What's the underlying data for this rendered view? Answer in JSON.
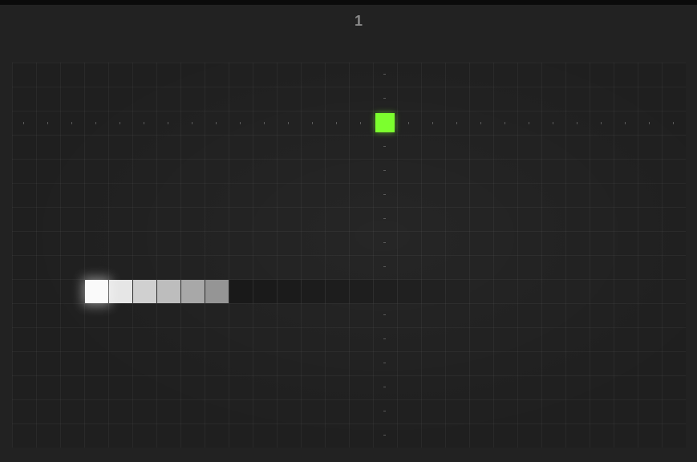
{
  "score": "1",
  "grid": {
    "cols": 28,
    "rows": 16
  },
  "food": {
    "col": 15,
    "row": 2,
    "color": "#7cff2e"
  },
  "snake": {
    "row": 9,
    "head_col": 3,
    "segments": [
      {
        "col": 3,
        "color": "#fafafa"
      },
      {
        "col": 4,
        "color": "#e6e6e6"
      },
      {
        "col": 5,
        "color": "#d0d0d0"
      },
      {
        "col": 6,
        "color": "#bdbdbd"
      },
      {
        "col": 7,
        "color": "#a8a8a8"
      },
      {
        "col": 8,
        "color": "#959595"
      },
      {
        "col": 9,
        "color": "#191919"
      },
      {
        "col": 10,
        "color": "#1a1a1a"
      },
      {
        "col": 11,
        "color": "#1b1b1b"
      },
      {
        "col": 12,
        "color": "#1c1c1c"
      },
      {
        "col": 13,
        "color": "#1d1d1d"
      },
      {
        "col": 14,
        "color": "#1e1e1e"
      },
      {
        "col": 15,
        "color": "#1f1f1f"
      },
      {
        "col": 16,
        "color": "#202020"
      },
      {
        "col": 17,
        "color": "#212121"
      },
      {
        "col": 18,
        "color": "#222222"
      }
    ]
  }
}
